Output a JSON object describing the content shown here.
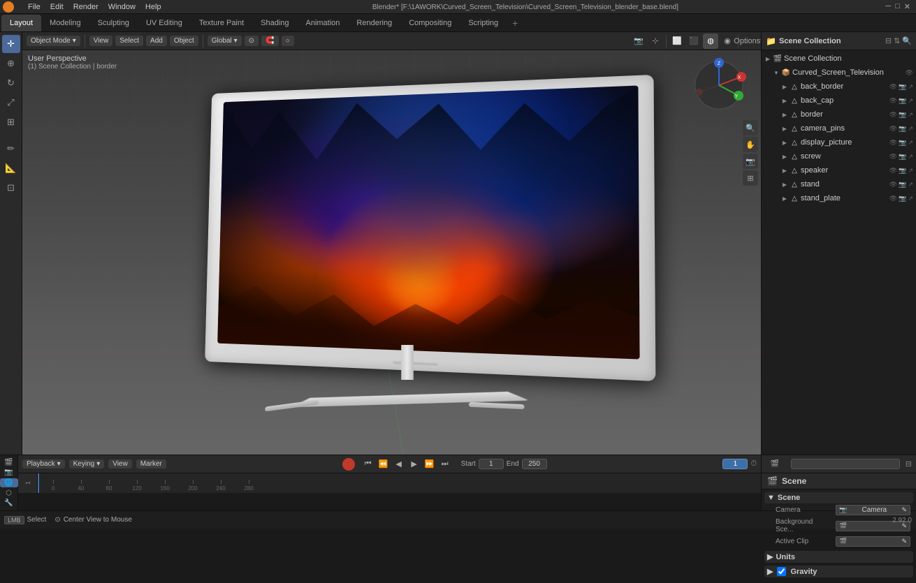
{
  "window": {
    "title": "Blender* [F:\\1AWORK\\Curved_Screen_Television\\Curved_Screen_Television_blender_base.blend]",
    "version": "2.92.0"
  },
  "menus": {
    "items": [
      "Blender",
      "File",
      "Edit",
      "Render",
      "Window",
      "Help"
    ]
  },
  "workspace_tabs": {
    "items": [
      "Layout",
      "Modeling",
      "Sculpting",
      "UV Editing",
      "Texture Paint",
      "Shading",
      "Animation",
      "Rendering",
      "Compositing",
      "Scripting"
    ],
    "active": "Layout"
  },
  "viewport": {
    "mode": "Object Mode",
    "view_label": "User Perspective",
    "context_label": "(1) Scene Collection | border",
    "global_label": "Global",
    "options_label": "Options"
  },
  "toolbar": {
    "tools": [
      {
        "name": "cursor-tool",
        "icon": "✛"
      },
      {
        "name": "move-tool",
        "icon": "⊕"
      },
      {
        "name": "rotate-tool",
        "icon": "↻"
      },
      {
        "name": "scale-tool",
        "icon": "⤢"
      },
      {
        "name": "transform-tool",
        "icon": "⊞"
      },
      {
        "name": "annotate-tool",
        "icon": "✏"
      },
      {
        "name": "measure-tool",
        "icon": "📏"
      },
      {
        "name": "add-tool",
        "icon": "⊡"
      }
    ]
  },
  "scene_collection": {
    "label": "Scene Collection",
    "root": "Curved_Screen_Television",
    "items": [
      {
        "name": "back_border",
        "level": 2,
        "icons": [
          "eye",
          "render",
          "select"
        ]
      },
      {
        "name": "back_cap",
        "level": 2,
        "icons": [
          "eye",
          "render",
          "select"
        ]
      },
      {
        "name": "border",
        "level": 2,
        "icons": [
          "eye",
          "render",
          "select"
        ]
      },
      {
        "name": "camera_pins",
        "level": 2,
        "icons": [
          "eye",
          "render",
          "select"
        ]
      },
      {
        "name": "display_picture",
        "level": 2,
        "icons": [
          "eye",
          "render",
          "select"
        ]
      },
      {
        "name": "screw",
        "level": 2,
        "icons": [
          "eye",
          "render",
          "select"
        ]
      },
      {
        "name": "speaker",
        "level": 2,
        "icons": [
          "eye",
          "render",
          "select"
        ]
      },
      {
        "name": "stand",
        "level": 2,
        "icons": [
          "eye",
          "render",
          "select"
        ]
      },
      {
        "name": "stand_plate",
        "level": 2,
        "icons": [
          "eye",
          "render",
          "select"
        ]
      }
    ]
  },
  "props_panel": {
    "search_placeholder": "",
    "scene_label": "Scene",
    "scene_section": {
      "label": "Scene",
      "fields": [
        {
          "label": "Camera",
          "value": "Camera",
          "has_icon": true
        },
        {
          "label": "Background Sce...",
          "value": "",
          "has_icon": true
        },
        {
          "label": "Active Clip",
          "value": "",
          "has_icon": true
        }
      ]
    },
    "units_section": {
      "label": "Units"
    },
    "gravity_section": {
      "label": "Gravity",
      "checked": true
    }
  },
  "timeline": {
    "playback_label": "Playback",
    "keying_label": "Keying",
    "view_label": "View",
    "marker_label": "Marker",
    "current_frame": "1",
    "start_label": "Start",
    "start_value": "1",
    "end_label": "End",
    "end_value": "250",
    "ruler_ticks": [
      "1",
      "40",
      "80",
      "120",
      "160",
      "200",
      "240",
      "280"
    ],
    "tick_labels": [
      "0",
      "40",
      "80",
      "120",
      "160",
      "200",
      "240",
      "280"
    ]
  },
  "status_bar": {
    "select_label": "Select",
    "shortcut_label": "Center View to Mouse",
    "version": "2.92.0",
    "items": [
      {
        "key": "LMB",
        "action": "Select"
      },
      {
        "key": "",
        "action": "Center View to Mouse"
      }
    ]
  },
  "render_engine": "RenderLayer",
  "scene_name": "Scene"
}
